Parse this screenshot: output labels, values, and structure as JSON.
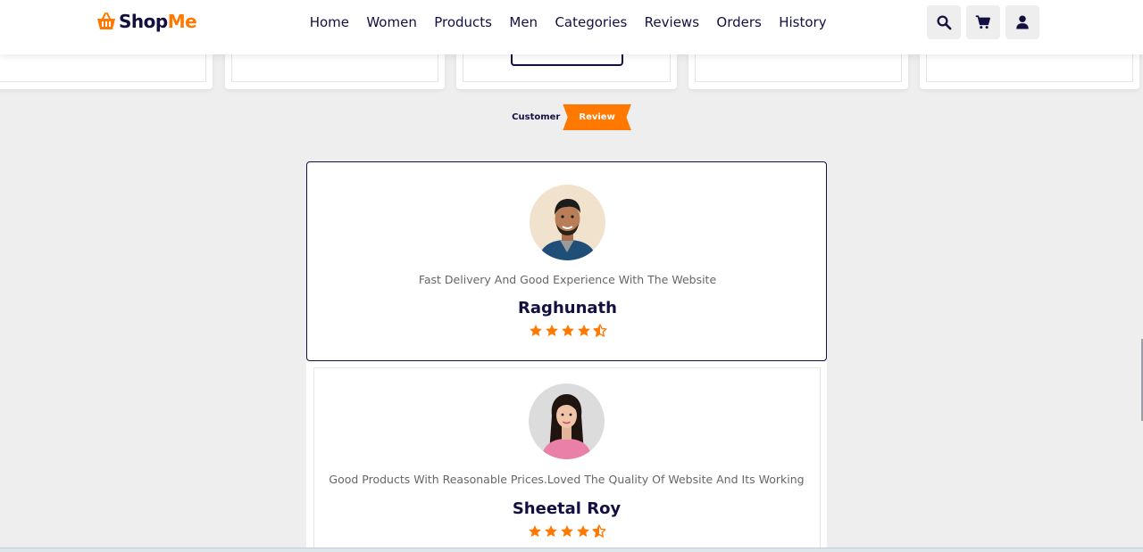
{
  "header": {
    "logo": {
      "part1": "Shop",
      "part2": "Me"
    },
    "nav": [
      "Home",
      "Women",
      "Products",
      "Men",
      "Categories",
      "Reviews",
      "Orders",
      "History"
    ],
    "icons": [
      "search-icon",
      "cart-icon",
      "user-icon"
    ]
  },
  "section": {
    "heading_plain": "Customer",
    "heading_accent": "Review"
  },
  "reviews": [
    {
      "text": "Fast Delivery And Good Experience With The Website",
      "name": "Raghunath",
      "rating": 4.5
    },
    {
      "text": "Good Products With Reasonable Prices.Loved The Quality Of Website And Its Working",
      "name": "Sheetal Roy",
      "rating": 4.5
    }
  ],
  "colors": {
    "accent": "#ff7800",
    "dark": "#130f40",
    "light_bg": "#eeeeee"
  }
}
